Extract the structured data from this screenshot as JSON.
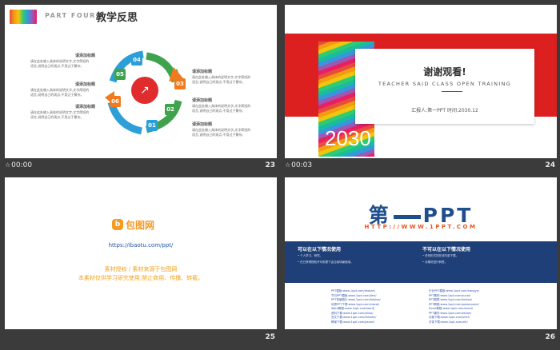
{
  "slides": [
    {
      "number": "23",
      "timing": "00:00",
      "part_label": "PART FOUR",
      "title": "教学反思",
      "items": [
        {
          "num": "04",
          "label": "请添加标题",
          "text": "请在此处输入具体的说明文字,文字简短的\n语言,说明自己的观点,不用过于繁杂。"
        },
        {
          "num": "05",
          "label": "请添加标题",
          "text": "请在此处输入具体的说明文字,文字简短的\n语言,说明自己的观点,不用过于繁杂。"
        },
        {
          "num": "06",
          "label": "请添加标题",
          "text": "请在此处输入具体的说明文字,文字简短的\n语言,说明自己的观点,不用过于繁杂。"
        },
        {
          "num": "03",
          "label": "请添加标题",
          "text": "请在此处输入具体的说明文字,文字简短的\n语言,说明自己的观点,不用过于繁杂。"
        },
        {
          "num": "02",
          "label": "请添加标题",
          "text": "请在此处输入具体的说明文字,文字简短的\n语言,说明自己的观点,不用过于繁杂。"
        },
        {
          "num": "01",
          "label": "请添加标题",
          "text": "请在此处输入具体的说明文字,文字简短的\n语言,说明自己的观点,不用过于繁杂。"
        }
      ]
    },
    {
      "number": "24",
      "timing": "00:03",
      "title": "谢谢观看!",
      "subtitle": "TEACHER SAID CLASS OPEN TRAINING",
      "info": "汇报人:第一PPT  时间:2030.12",
      "year": "2030"
    },
    {
      "number": "25",
      "logo_mark": "b",
      "logo_text": "包图网",
      "url": "https://ibaotu.com/ppt/",
      "line1": "素材授权 / 素材来源于包图网",
      "line2": "本素材仅供学习研究使用,禁止商用、传播、转载。"
    },
    {
      "number": "26",
      "logo_left": "第",
      "logo_right": "PPT",
      "url": "HTTP://WWW.1PPT.COM",
      "can_title": "可以在以下情况使用",
      "can_items": [
        "• 个人学习、研究。",
        "• 在已获得授权许可前提下由当前场景使用。"
      ],
      "cannot_title": "不可以在以下情况使用",
      "cannot_items": [
        "• 任何形式的在线付费下载。",
        "• 对素材进行转售。"
      ],
      "links_left": [
        "PPT模板:www.1ppt.com/moban/",
        "节日PPT模板:www.1ppt.com/jieri/",
        "PPT背景图片:www.1ppt.com/beijing/",
        "优秀PPT下载:www.1ppt.com/xiazai/",
        "Word教程:www.1ppt.com/word/",
        "资料下载:www.1ppt.com/ziliao/",
        "范文下载:www.1ppt.com/fanwen/",
        "教案下载:www.1ppt.com/jiaoan/"
      ],
      "links_right": [
        "行业PPT模板:www.1ppt.com/hangye/",
        "PPT素材:www.1ppt.com/sucai/",
        "PPT图表:www.1ppt.com/tubiao/",
        "PPT教程:www.1ppt.com/powerpoint/",
        "Excel教程:www.1ppt.com/excel/",
        "PPT课件:www.1ppt.com/kejian/",
        "试卷下载:www.1ppt.com/shiti/",
        "字体下载:www.1ppt.com/ziti/"
      ]
    }
  ]
}
